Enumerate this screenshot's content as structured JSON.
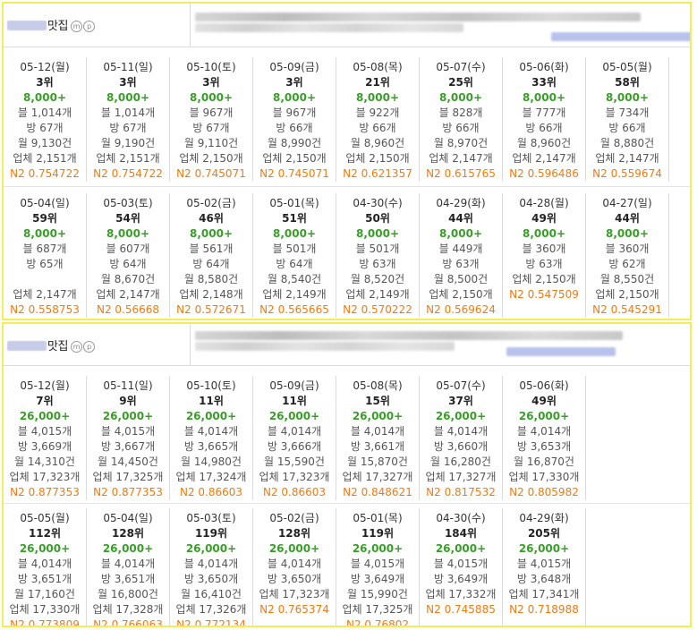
{
  "colors": {
    "highlight_border": "#f2ee58",
    "count_green": "#3a9d2a",
    "n2_orange": "#ef7a12"
  },
  "panels": [
    {
      "brand": "맛집",
      "badges": [
        "m",
        "p"
      ],
      "rows": [
        [
          {
            "date": "05-12(월)",
            "rank": "3위",
            "count": "8,000+",
            "blog": "블 1,014개",
            "bang": "방 67개",
            "month": "월 9,130건",
            "biz": "업체 2,151개",
            "n2": "N2 0.754722"
          },
          {
            "date": "05-11(일)",
            "rank": "3위",
            "count": "8,000+",
            "blog": "블 1,014개",
            "bang": "방 67개",
            "month": "월 9,190건",
            "biz": "업체 2,151개",
            "n2": "N2 0.754722"
          },
          {
            "date": "05-10(토)",
            "rank": "3위",
            "count": "8,000+",
            "blog": "블 967개",
            "bang": "방 67개",
            "month": "월 9,110건",
            "biz": "업체 2,150개",
            "n2": "N2 0.745071"
          },
          {
            "date": "05-09(금)",
            "rank": "3위",
            "count": "8,000+",
            "blog": "블 967개",
            "bang": "방 66개",
            "month": "월 8,990건",
            "biz": "업체 2,150개",
            "n2": "N2 0.745071"
          },
          {
            "date": "05-08(목)",
            "rank": "21위",
            "count": "8,000+",
            "blog": "블 922개",
            "bang": "방 66개",
            "month": "월 8,960건",
            "biz": "업체 2,150개",
            "n2": "N2 0.621357"
          },
          {
            "date": "05-07(수)",
            "rank": "25위",
            "count": "8,000+",
            "blog": "블 828개",
            "bang": "방 66개",
            "month": "월 8,970건",
            "biz": "업체 2,147개",
            "n2": "N2 0.615765"
          },
          {
            "date": "05-06(화)",
            "rank": "33위",
            "count": "8,000+",
            "blog": "블 777개",
            "bang": "방 66개",
            "month": "월 8,960건",
            "biz": "업체 2,147개",
            "n2": "N2 0.596486"
          },
          {
            "date": "05-05(월)",
            "rank": "58위",
            "count": "8,000+",
            "blog": "블 734개",
            "bang": "방 66개",
            "month": "월 8,880건",
            "biz": "업체 2,147개",
            "n2": "N2 0.559674"
          }
        ],
        [
          {
            "date": "05-04(일)",
            "rank": "59위",
            "count": "8,000+",
            "blog": "블 687개",
            "bang": "방 65개",
            "month": "",
            "biz": "업체 2,147개",
            "n2": "N2 0.558753"
          },
          {
            "date": "05-03(토)",
            "rank": "54위",
            "count": "8,000+",
            "blog": "블 607개",
            "bang": "방 64개",
            "month": "월 8,670건",
            "biz": "업체 2,147개",
            "n2": "N2 0.56668"
          },
          {
            "date": "05-02(금)",
            "rank": "46위",
            "count": "8,000+",
            "blog": "블 561개",
            "bang": "방 64개",
            "month": "월 8,580건",
            "biz": "업체 2,148개",
            "n2": "N2 0.572671"
          },
          {
            "date": "05-01(목)",
            "rank": "51위",
            "count": "8,000+",
            "blog": "블 501개",
            "bang": "방 64개",
            "month": "월 8,540건",
            "biz": "업체 2,149개",
            "n2": "N2 0.565665"
          },
          {
            "date": "04-30(수)",
            "rank": "50위",
            "count": "8,000+",
            "blog": "블 501개",
            "bang": "방 63개",
            "month": "월 8,520건",
            "biz": "업체 2,149개",
            "n2": "N2 0.570222"
          },
          {
            "date": "04-29(화)",
            "rank": "44위",
            "count": "8,000+",
            "blog": "블 449개",
            "bang": "방 63개",
            "month": "월 8,500건",
            "biz": "업체 2,150개",
            "n2": "N2 0.569624"
          },
          {
            "date": "04-28(월)",
            "rank": "49위",
            "count": "8,000+",
            "blog": "블 360개",
            "bang": "방 63개",
            "month": "업체 2,150개",
            "biz": "N2 0.547509",
            "n2": ""
          },
          {
            "date": "04-27(일)",
            "rank": "44위",
            "count": "8,000+",
            "blog": "블 360개",
            "bang": "방 62개",
            "month": "월 8,550건",
            "biz": "업체 2,150개",
            "n2": "N2 0.545291"
          }
        ]
      ]
    },
    {
      "brand": "맛집",
      "badges": [
        "m",
        "p"
      ],
      "rows": [
        [
          {
            "date": "05-12(월)",
            "rank": "7위",
            "count": "26,000+",
            "blog": "블 4,015개",
            "bang": "방 3,669개",
            "month": "월 14,310건",
            "biz": "업체 17,323개",
            "n2": "N2 0.877353"
          },
          {
            "date": "05-11(일)",
            "rank": "9위",
            "count": "26,000+",
            "blog": "블 4,015개",
            "bang": "방 3,667개",
            "month": "월 14,450건",
            "biz": "업체 17,325개",
            "n2": "N2 0.877353"
          },
          {
            "date": "05-10(토)",
            "rank": "11위",
            "count": "26,000+",
            "blog": "블 4,014개",
            "bang": "방 3,665개",
            "month": "월 14,980건",
            "biz": "업체 17,324개",
            "n2": "N2 0.86603"
          },
          {
            "date": "05-09(금)",
            "rank": "11위",
            "count": "26,000+",
            "blog": "블 4,014개",
            "bang": "방 3,666개",
            "month": "월 15,590건",
            "biz": "업체 17,323개",
            "n2": "N2 0.86603"
          },
          {
            "date": "05-08(목)",
            "rank": "15위",
            "count": "26,000+",
            "blog": "블 4,014개",
            "bang": "방 3,661개",
            "month": "월 15,870건",
            "biz": "업체 17,327개",
            "n2": "N2 0.848621"
          },
          {
            "date": "05-07(수)",
            "rank": "37위",
            "count": "26,000+",
            "blog": "블 4,014개",
            "bang": "방 3,660개",
            "month": "월 16,280건",
            "biz": "업체 17,327개",
            "n2": "N2 0.817532"
          },
          {
            "date": "05-06(화)",
            "rank": "49위",
            "count": "26,000+",
            "blog": "블 4,014개",
            "bang": "방 3,653개",
            "month": "월 16,870건",
            "biz": "업체 17,330개",
            "n2": "N2 0.805982"
          }
        ],
        [
          {
            "date": "05-05(월)",
            "rank": "112위",
            "count": "26,000+",
            "blog": "블 4,014개",
            "bang": "방 3,651개",
            "month": "월 17,160건",
            "biz": "업체 17,330개",
            "n2": "N2 0.773809"
          },
          {
            "date": "05-04(일)",
            "rank": "128위",
            "count": "26,000+",
            "blog": "블 4,014개",
            "bang": "방 3,651개",
            "month": "월 16,800건",
            "biz": "업체 17,328개",
            "n2": "N2 0.766063"
          },
          {
            "date": "05-03(토)",
            "rank": "119위",
            "count": "26,000+",
            "blog": "블 4,014개",
            "bang": "방 3,650개",
            "month": "월 16,410건",
            "biz": "업체 17,326개",
            "n2": "N2 0.772134"
          },
          {
            "date": "05-02(금)",
            "rank": "128위",
            "count": "26,000+",
            "blog": "블 4,014개",
            "bang": "방 3,650개",
            "month": "업체 17,323개",
            "biz": "N2 0.765374",
            "n2": ""
          },
          {
            "date": "05-01(목)",
            "rank": "119위",
            "count": "26,000+",
            "blog": "블 4,015개",
            "bang": "방 3,649개",
            "month": "월 15,990건",
            "biz": "업체 17,325개",
            "n2": "N2 0.76802"
          },
          {
            "date": "04-30(수)",
            "rank": "184위",
            "count": "26,000+",
            "blog": "블 4,015개",
            "bang": "방 3,649개",
            "month": "업체 17,332개",
            "biz": "N2 0.745885",
            "n2": ""
          },
          {
            "date": "04-29(화)",
            "rank": "205위",
            "count": "26,000+",
            "blog": "블 4,015개",
            "bang": "방 3,648개",
            "month": "업체 17,341개",
            "biz": "N2 0.718988",
            "n2": ""
          }
        ]
      ]
    }
  ]
}
